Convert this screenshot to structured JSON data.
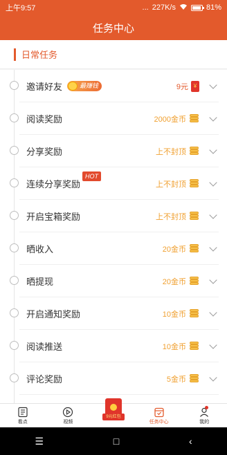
{
  "status": {
    "time": "上午9:57",
    "dots": "...",
    "speed": "227K/s",
    "battery": "81%"
  },
  "page_title": "任务中心",
  "section_title": "日常任务",
  "tasks": [
    {
      "name": "邀请好友",
      "badge": "最赚钱",
      "reward": "9元",
      "reward_icon": "red-packet-icon"
    },
    {
      "name": "阅读奖励",
      "reward": "2000金币",
      "reward_icon": "coin-stack-icon"
    },
    {
      "name": "分享奖励",
      "reward": "上不封顶",
      "reward_icon": "coin-stack-icon"
    },
    {
      "name": "连续分享奖励",
      "hot": "HOT",
      "reward": "上不封顶",
      "reward_icon": "coin-stack-icon"
    },
    {
      "name": "开启宝箱奖励",
      "reward": "上不封顶",
      "reward_icon": "coin-stack-icon"
    },
    {
      "name": "晒收入",
      "reward": "20金币",
      "reward_icon": "coin-stack-icon"
    },
    {
      "name": "晒提现",
      "reward": "20金币",
      "reward_icon": "coin-stack-icon"
    },
    {
      "name": "开启通知奖励",
      "reward": "10金币",
      "reward_icon": "coin-stack-icon"
    },
    {
      "name": "阅读推送",
      "reward": "10金币",
      "reward_icon": "coin-stack-icon"
    },
    {
      "name": "评论奖励",
      "reward": "5金币",
      "reward_icon": "coin-stack-icon"
    }
  ],
  "tabs": [
    {
      "label": "看点",
      "icon": "article-icon"
    },
    {
      "label": "视频",
      "icon": "play-icon"
    },
    {
      "label": "9元红包",
      "icon": "red-envelope-icon"
    },
    {
      "label": "任务中心",
      "icon": "task-icon",
      "active": true
    },
    {
      "label": "我的",
      "icon": "profile-icon"
    }
  ],
  "colors": {
    "brand": "#e35a2c",
    "reward_gold": "#f0a030",
    "hot_red": "#e24a2d"
  }
}
